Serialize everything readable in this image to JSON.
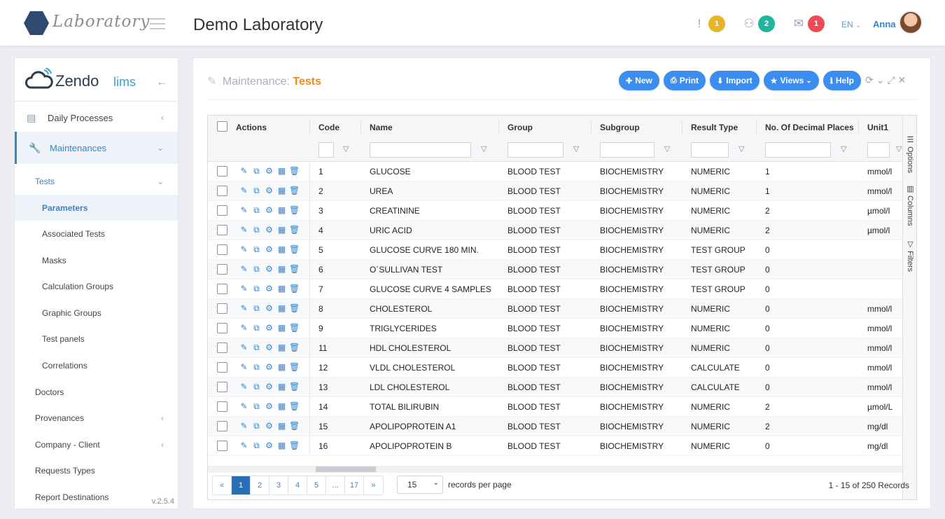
{
  "topbar": {
    "logo_text": "Laboratory",
    "title": "Demo Laboratory",
    "notifications": [
      {
        "icon": "exclamation-icon",
        "glyph": "!",
        "count": "1",
        "color": "#e8b427"
      },
      {
        "icon": "users-icon",
        "glyph": "⚇",
        "count": "2",
        "color": "#1fb59f"
      },
      {
        "icon": "inbox-icon",
        "glyph": "✉",
        "count": "1",
        "color": "#ee4a55"
      }
    ],
    "language": "EN",
    "user": "Anna"
  },
  "sidebar": {
    "brand_main": "Zendo",
    "brand_sub": "lims",
    "items": [
      {
        "label": "Daily Processes",
        "icon": "newspaper-icon"
      },
      {
        "label": "Maintenances",
        "icon": "wrench-icon"
      }
    ],
    "submenu_title": "Tests",
    "submenu": [
      {
        "label": "Parameters"
      },
      {
        "label": "Associated Tests"
      },
      {
        "label": "Masks"
      },
      {
        "label": "Calculation Groups"
      },
      {
        "label": "Graphic Groups"
      },
      {
        "label": "Test panels"
      },
      {
        "label": "Correlations"
      }
    ],
    "more": [
      {
        "label": "Doctors",
        "chevron": false
      },
      {
        "label": "Provenances",
        "chevron": true
      },
      {
        "label": "Company - Client",
        "chevron": true
      },
      {
        "label": "Requests Types",
        "chevron": false
      },
      {
        "label": "Report Destinations",
        "chevron": false
      }
    ],
    "version": "v.2.5.4"
  },
  "panel": {
    "title_prefix": "Maintenance:",
    "title_name": "Tests",
    "buttons": [
      {
        "label": "New",
        "icon": "plus-icon",
        "glyph": "✚"
      },
      {
        "label": "Print",
        "icon": "print-icon",
        "glyph": "⎙"
      },
      {
        "label": "Import",
        "icon": "download-icon",
        "glyph": "⬇"
      },
      {
        "label": "Views",
        "icon": "star-icon",
        "glyph": "★"
      },
      {
        "label": "Help",
        "icon": "info-icon",
        "glyph": "ℹ"
      }
    ]
  },
  "grid": {
    "columns": [
      "Actions",
      "Code",
      "Name",
      "Group",
      "Subgroup",
      "Result Type",
      "No. Of Decimal Places",
      "Unit1"
    ],
    "side_tabs": [
      "Options",
      "Columns",
      "Filters"
    ],
    "rows": [
      [
        "1",
        "GLUCOSE",
        "BLOOD TEST",
        "BIOCHEMISTRY",
        "NUMERIC",
        "1",
        "mmol/l"
      ],
      [
        "2",
        "UREA",
        "BLOOD TEST",
        "BIOCHEMISTRY",
        "NUMERIC",
        "1",
        "mmol/l"
      ],
      [
        "3",
        "CREATININE",
        "BLOOD TEST",
        "BIOCHEMISTRY",
        "NUMERIC",
        "2",
        "µmol/l"
      ],
      [
        "4",
        "URIC ACID",
        "BLOOD TEST",
        "BIOCHEMISTRY",
        "NUMERIC",
        "2",
        "µmol/l"
      ],
      [
        "5",
        "GLUCOSE CURVE 180 MIN.",
        "BLOOD TEST",
        "BIOCHEMISTRY",
        "TEST GROUP",
        "0",
        ""
      ],
      [
        "6",
        "O´SULLIVAN TEST",
        "BLOOD TEST",
        "BIOCHEMISTRY",
        "TEST GROUP",
        "0",
        ""
      ],
      [
        "7",
        "GLUCOSE CURVE 4 SAMPLES",
        "BLOOD TEST",
        "BIOCHEMISTRY",
        "TEST GROUP",
        "0",
        ""
      ],
      [
        "8",
        "CHOLESTEROL",
        "BLOOD TEST",
        "BIOCHEMISTRY",
        "NUMERIC",
        "0",
        "mmol/l"
      ],
      [
        "9",
        "TRIGLYCERIDES",
        "BLOOD TEST",
        "BIOCHEMISTRY",
        "NUMERIC",
        "0",
        "mmol/l"
      ],
      [
        "11",
        "HDL CHOLESTEROL",
        "BLOOD TEST",
        "BIOCHEMISTRY",
        "NUMERIC",
        "0",
        "mmol/l"
      ],
      [
        "12",
        "VLDL CHOLESTEROL",
        "BLOOD TEST",
        "BIOCHEMISTRY",
        "CALCULATE",
        "0",
        "mmol/l"
      ],
      [
        "13",
        "LDL CHOLESTEROL",
        "BLOOD TEST",
        "BIOCHEMISTRY",
        "CALCULATE",
        "0",
        "mmol/l"
      ],
      [
        "14",
        "TOTAL BILIRUBIN",
        "BLOOD TEST",
        "BIOCHEMISTRY",
        "NUMERIC",
        "2",
        "µmol/L"
      ],
      [
        "15",
        "APOLIPOPROTEIN A1",
        "BLOOD TEST",
        "BIOCHEMISTRY",
        "NUMERIC",
        "2",
        "mg/dl"
      ],
      [
        "16",
        "APOLIPOPROTEIN B",
        "BLOOD TEST",
        "BIOCHEMISTRY",
        "NUMERIC",
        "0",
        "mg/dl"
      ]
    ]
  },
  "pager": {
    "first": "«",
    "pages": [
      "1",
      "2",
      "3",
      "4",
      "5",
      "...",
      "17"
    ],
    "last": "»",
    "current": "1",
    "per_page": "15",
    "per_page_label": "records per page",
    "record_count": "1 - 15 of 250 Records"
  }
}
